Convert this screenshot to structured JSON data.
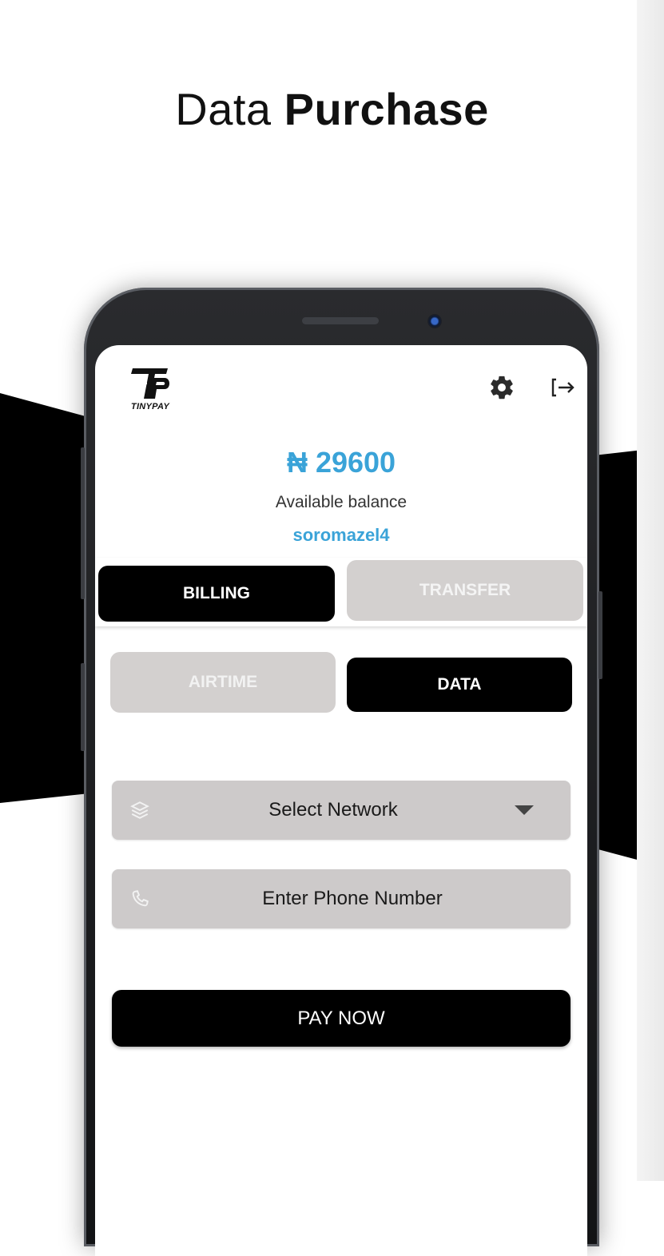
{
  "promo": {
    "title_light": "Data",
    "title_bold": "Purchase"
  },
  "app": {
    "logo_text": "TINYPAY",
    "balance": "₦ 29600",
    "balance_label": "Available balance",
    "username": "soromazel4",
    "accent_color": "#3aa3d8",
    "header_icons": [
      "gear-icon",
      "logout-icon"
    ]
  },
  "tabs": {
    "billing": "BILLING",
    "transfer": "TRANSFER",
    "active": "BILLING"
  },
  "sub_tabs": {
    "airtime": "AIRTIME",
    "data": "DATA",
    "active": "DATA"
  },
  "form": {
    "network_placeholder": "Select Network",
    "network_icon": "layers-icon",
    "phone_placeholder": "Enter Phone Number",
    "phone_icon": "phone-icon",
    "submit": "PAY NOW"
  }
}
